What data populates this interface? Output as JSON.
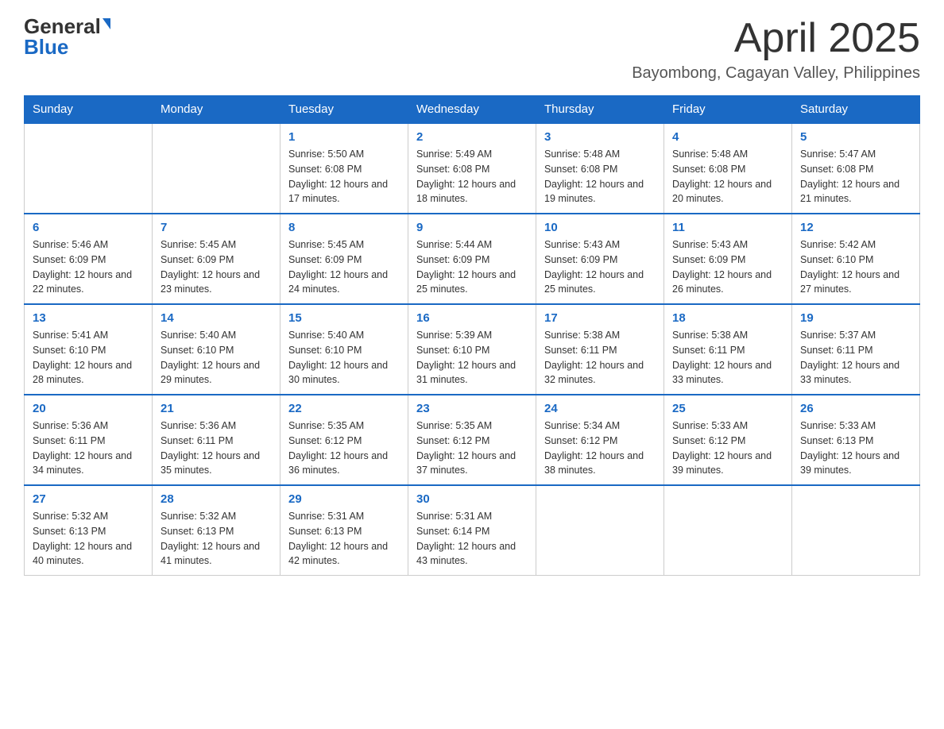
{
  "header": {
    "logo_general": "General",
    "logo_blue": "Blue",
    "month_title": "April 2025",
    "location": "Bayombong, Cagayan Valley, Philippines"
  },
  "weekdays": [
    "Sunday",
    "Monday",
    "Tuesday",
    "Wednesday",
    "Thursday",
    "Friday",
    "Saturday"
  ],
  "weeks": [
    [
      {
        "day": "",
        "sunrise": "",
        "sunset": "",
        "daylight": ""
      },
      {
        "day": "",
        "sunrise": "",
        "sunset": "",
        "daylight": ""
      },
      {
        "day": "1",
        "sunrise": "Sunrise: 5:50 AM",
        "sunset": "Sunset: 6:08 PM",
        "daylight": "Daylight: 12 hours and 17 minutes."
      },
      {
        "day": "2",
        "sunrise": "Sunrise: 5:49 AM",
        "sunset": "Sunset: 6:08 PM",
        "daylight": "Daylight: 12 hours and 18 minutes."
      },
      {
        "day": "3",
        "sunrise": "Sunrise: 5:48 AM",
        "sunset": "Sunset: 6:08 PM",
        "daylight": "Daylight: 12 hours and 19 minutes."
      },
      {
        "day": "4",
        "sunrise": "Sunrise: 5:48 AM",
        "sunset": "Sunset: 6:08 PM",
        "daylight": "Daylight: 12 hours and 20 minutes."
      },
      {
        "day": "5",
        "sunrise": "Sunrise: 5:47 AM",
        "sunset": "Sunset: 6:08 PM",
        "daylight": "Daylight: 12 hours and 21 minutes."
      }
    ],
    [
      {
        "day": "6",
        "sunrise": "Sunrise: 5:46 AM",
        "sunset": "Sunset: 6:09 PM",
        "daylight": "Daylight: 12 hours and 22 minutes."
      },
      {
        "day": "7",
        "sunrise": "Sunrise: 5:45 AM",
        "sunset": "Sunset: 6:09 PM",
        "daylight": "Daylight: 12 hours and 23 minutes."
      },
      {
        "day": "8",
        "sunrise": "Sunrise: 5:45 AM",
        "sunset": "Sunset: 6:09 PM",
        "daylight": "Daylight: 12 hours and 24 minutes."
      },
      {
        "day": "9",
        "sunrise": "Sunrise: 5:44 AM",
        "sunset": "Sunset: 6:09 PM",
        "daylight": "Daylight: 12 hours and 25 minutes."
      },
      {
        "day": "10",
        "sunrise": "Sunrise: 5:43 AM",
        "sunset": "Sunset: 6:09 PM",
        "daylight": "Daylight: 12 hours and 25 minutes."
      },
      {
        "day": "11",
        "sunrise": "Sunrise: 5:43 AM",
        "sunset": "Sunset: 6:09 PM",
        "daylight": "Daylight: 12 hours and 26 minutes."
      },
      {
        "day": "12",
        "sunrise": "Sunrise: 5:42 AM",
        "sunset": "Sunset: 6:10 PM",
        "daylight": "Daylight: 12 hours and 27 minutes."
      }
    ],
    [
      {
        "day": "13",
        "sunrise": "Sunrise: 5:41 AM",
        "sunset": "Sunset: 6:10 PM",
        "daylight": "Daylight: 12 hours and 28 minutes."
      },
      {
        "day": "14",
        "sunrise": "Sunrise: 5:40 AM",
        "sunset": "Sunset: 6:10 PM",
        "daylight": "Daylight: 12 hours and 29 minutes."
      },
      {
        "day": "15",
        "sunrise": "Sunrise: 5:40 AM",
        "sunset": "Sunset: 6:10 PM",
        "daylight": "Daylight: 12 hours and 30 minutes."
      },
      {
        "day": "16",
        "sunrise": "Sunrise: 5:39 AM",
        "sunset": "Sunset: 6:10 PM",
        "daylight": "Daylight: 12 hours and 31 minutes."
      },
      {
        "day": "17",
        "sunrise": "Sunrise: 5:38 AM",
        "sunset": "Sunset: 6:11 PM",
        "daylight": "Daylight: 12 hours and 32 minutes."
      },
      {
        "day": "18",
        "sunrise": "Sunrise: 5:38 AM",
        "sunset": "Sunset: 6:11 PM",
        "daylight": "Daylight: 12 hours and 33 minutes."
      },
      {
        "day": "19",
        "sunrise": "Sunrise: 5:37 AM",
        "sunset": "Sunset: 6:11 PM",
        "daylight": "Daylight: 12 hours and 33 minutes."
      }
    ],
    [
      {
        "day": "20",
        "sunrise": "Sunrise: 5:36 AM",
        "sunset": "Sunset: 6:11 PM",
        "daylight": "Daylight: 12 hours and 34 minutes."
      },
      {
        "day": "21",
        "sunrise": "Sunrise: 5:36 AM",
        "sunset": "Sunset: 6:11 PM",
        "daylight": "Daylight: 12 hours and 35 minutes."
      },
      {
        "day": "22",
        "sunrise": "Sunrise: 5:35 AM",
        "sunset": "Sunset: 6:12 PM",
        "daylight": "Daylight: 12 hours and 36 minutes."
      },
      {
        "day": "23",
        "sunrise": "Sunrise: 5:35 AM",
        "sunset": "Sunset: 6:12 PM",
        "daylight": "Daylight: 12 hours and 37 minutes."
      },
      {
        "day": "24",
        "sunrise": "Sunrise: 5:34 AM",
        "sunset": "Sunset: 6:12 PM",
        "daylight": "Daylight: 12 hours and 38 minutes."
      },
      {
        "day": "25",
        "sunrise": "Sunrise: 5:33 AM",
        "sunset": "Sunset: 6:12 PM",
        "daylight": "Daylight: 12 hours and 39 minutes."
      },
      {
        "day": "26",
        "sunrise": "Sunrise: 5:33 AM",
        "sunset": "Sunset: 6:13 PM",
        "daylight": "Daylight: 12 hours and 39 minutes."
      }
    ],
    [
      {
        "day": "27",
        "sunrise": "Sunrise: 5:32 AM",
        "sunset": "Sunset: 6:13 PM",
        "daylight": "Daylight: 12 hours and 40 minutes."
      },
      {
        "day": "28",
        "sunrise": "Sunrise: 5:32 AM",
        "sunset": "Sunset: 6:13 PM",
        "daylight": "Daylight: 12 hours and 41 minutes."
      },
      {
        "day": "29",
        "sunrise": "Sunrise: 5:31 AM",
        "sunset": "Sunset: 6:13 PM",
        "daylight": "Daylight: 12 hours and 42 minutes."
      },
      {
        "day": "30",
        "sunrise": "Sunrise: 5:31 AM",
        "sunset": "Sunset: 6:14 PM",
        "daylight": "Daylight: 12 hours and 43 minutes."
      },
      {
        "day": "",
        "sunrise": "",
        "sunset": "",
        "daylight": ""
      },
      {
        "day": "",
        "sunrise": "",
        "sunset": "",
        "daylight": ""
      },
      {
        "day": "",
        "sunrise": "",
        "sunset": "",
        "daylight": ""
      }
    ]
  ]
}
